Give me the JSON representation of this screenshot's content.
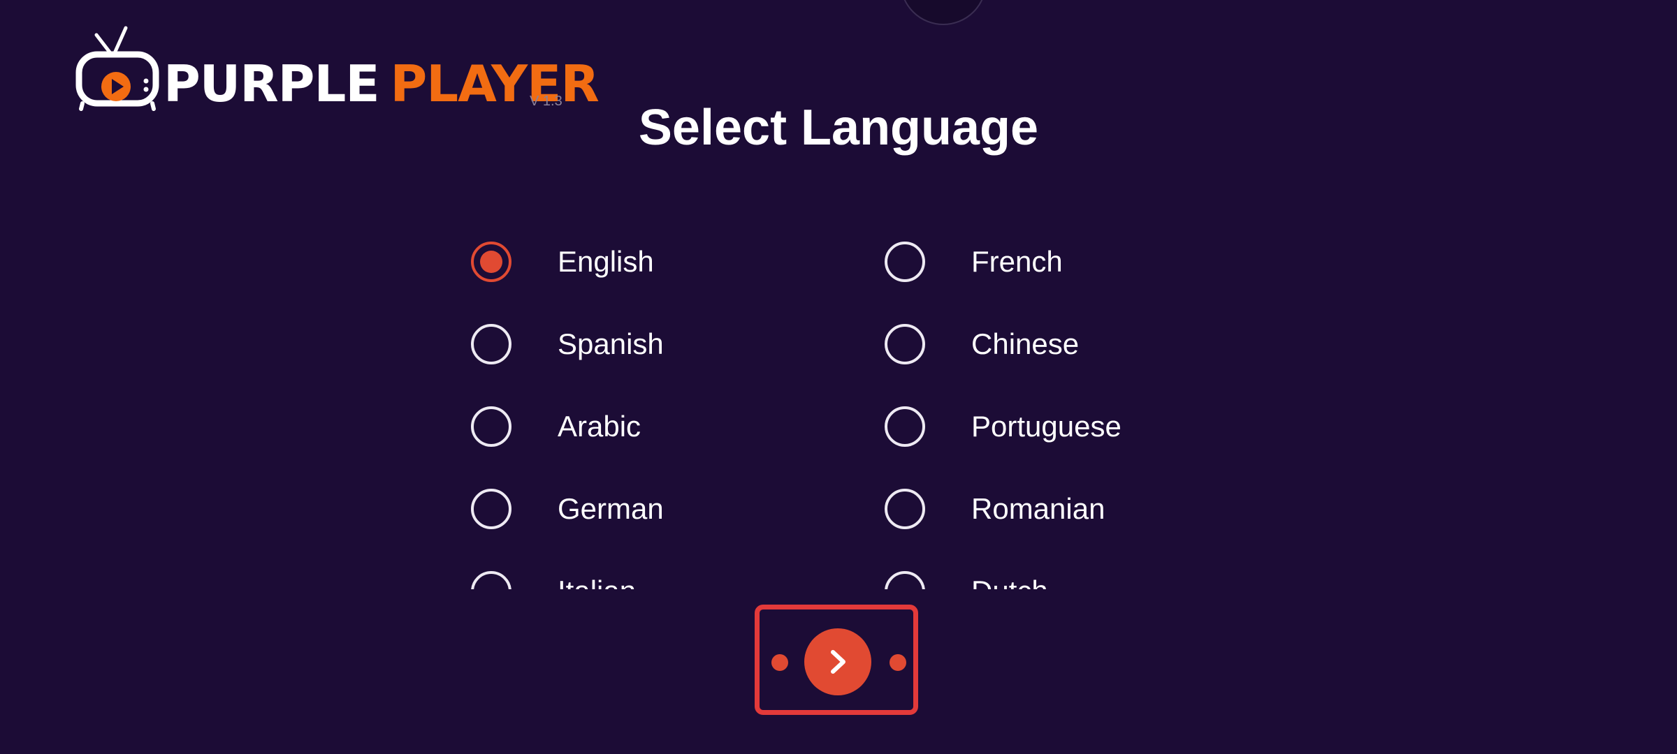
{
  "app": {
    "logo_text_primary": "PURPLE",
    "logo_text_secondary": "PLAYER",
    "version": "V 1.3"
  },
  "page": {
    "title": "Select Language"
  },
  "languages": {
    "selected": "English",
    "options": [
      {
        "label": "English",
        "selected": true
      },
      {
        "label": "French",
        "selected": false
      },
      {
        "label": "Spanish",
        "selected": false
      },
      {
        "label": "Chinese",
        "selected": false
      },
      {
        "label": "Arabic",
        "selected": false
      },
      {
        "label": "Portuguese",
        "selected": false
      },
      {
        "label": "German",
        "selected": false
      },
      {
        "label": "Romanian",
        "selected": false
      },
      {
        "label": "Italian",
        "selected": false
      },
      {
        "label": "Dutch",
        "selected": false
      }
    ]
  },
  "navigation": {
    "next_icon": "chevron-right-icon"
  },
  "colors": {
    "background": "#1c0c36",
    "accent": "#e14a32",
    "logo_orange": "#f26c12",
    "focus_outline": "#e33a3a"
  }
}
